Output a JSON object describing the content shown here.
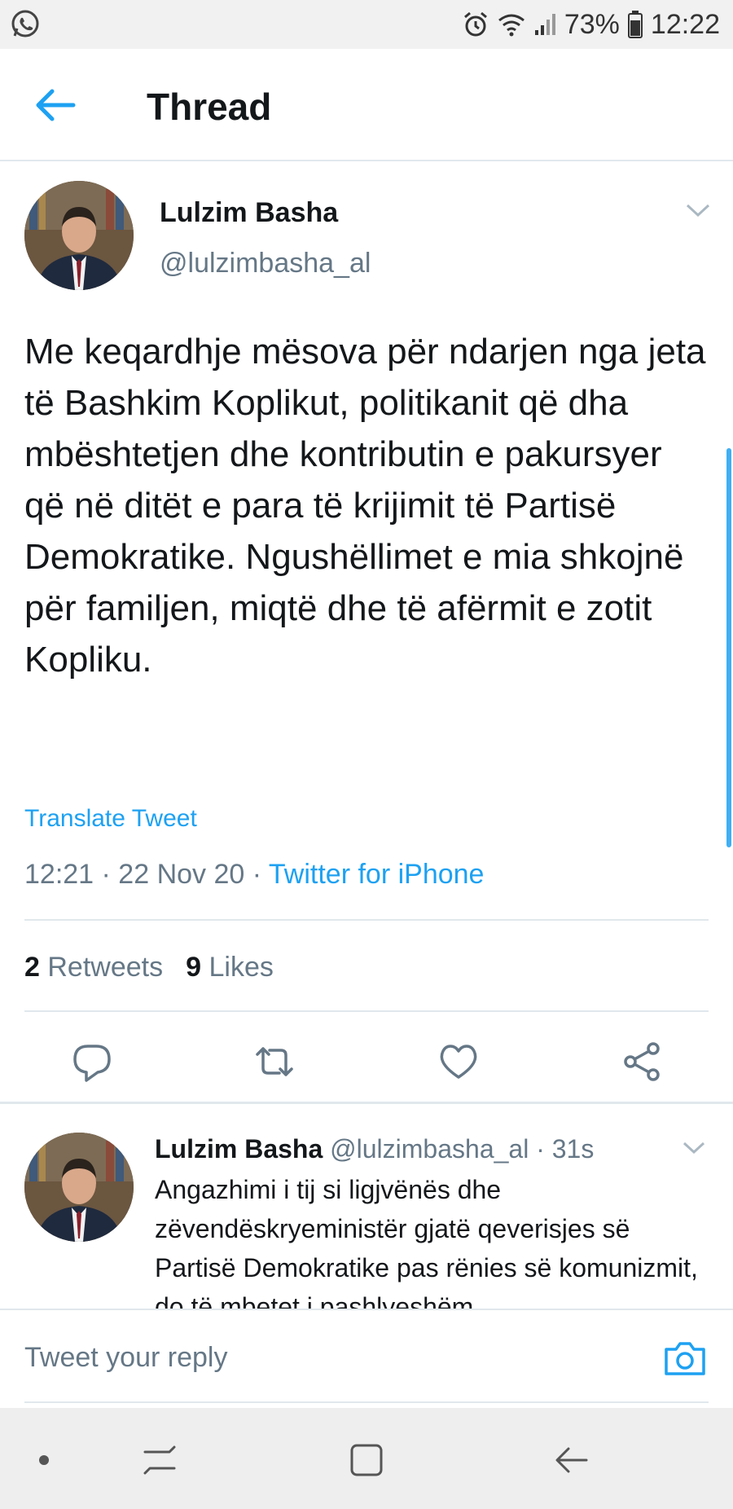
{
  "status_bar": {
    "battery": "73%",
    "time": "12:22"
  },
  "header": {
    "title": "Thread"
  },
  "tweet": {
    "author_name": "Lulzim Basha",
    "author_handle": "@lulzimbasha_al",
    "text": "Me keqardhje mësova për ndarjen nga jeta të Bashkim Koplikut, politikanit që dha mbështetjen dhe kontributin e pakursyer që në ditët e para të krijimit të Partisë Demokratike. Ngushëllimet e mia shkojnë për familjen, miqtë dhe të afërmit e zotit Kopliku.",
    "translate_label": "Translate Tweet",
    "timestamp": "12:21 · 22 Nov 20 · ",
    "source": "Twitter for iPhone",
    "retweets_count": "2",
    "retweets_label": "Retweets",
    "likes_count": "9",
    "likes_label": "Likes"
  },
  "reply": {
    "author_name": "Lulzim Basha",
    "meta": " @lulzimbasha_al · 31s",
    "text": "Angazhimi i tij si ligjvënës dhe zëvendëskryeministër gjatë qeverisjes së Partisë Demokratike pas rënies së komunizmit, do të mbetet i pashlyeshëm"
  },
  "composer": {
    "placeholder": "Tweet your reply"
  },
  "colors": {
    "accent": "#1da1f2",
    "secondary_text": "#657786",
    "divider": "#e1e8ed"
  },
  "icons": {
    "status_left": "whatsapp-icon",
    "status_right": [
      "alarm-icon",
      "wifi-icon",
      "signal-icon",
      "battery-icon"
    ],
    "header": "back-arrow-icon",
    "tweet_menu": "chevron-down-icon",
    "actions": [
      "reply-icon",
      "retweet-icon",
      "like-icon",
      "share-icon"
    ],
    "composer": "camera-icon",
    "navbar": [
      "dot-icon",
      "recent-apps-icon",
      "home-icon",
      "back-icon"
    ]
  }
}
